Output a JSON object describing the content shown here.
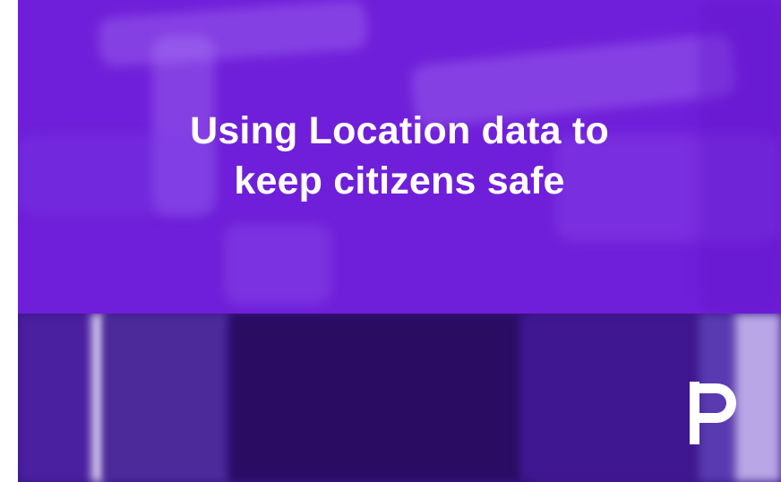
{
  "headline": {
    "line1": "Using Location data to",
    "line2": "keep citizens safe"
  },
  "logo": {
    "icon": "brand-p-logo"
  },
  "colors": {
    "top_band": "#6f1fd9",
    "bottom_band": "#3b1688",
    "text": "#ffffff"
  }
}
